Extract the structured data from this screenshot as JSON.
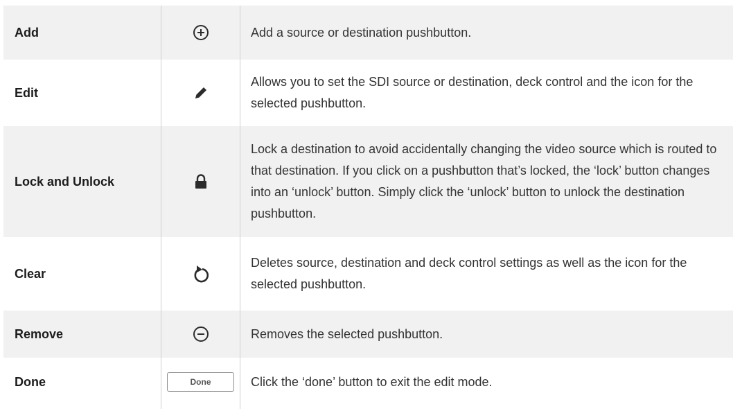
{
  "rows": [
    {
      "label": "Add",
      "icon": "plus-circle-icon",
      "description": "Add a source or destination pushbutton."
    },
    {
      "label": "Edit",
      "icon": "pencil-icon",
      "description": "Allows you to set the SDI source or destination, deck control and the icon for the selected pushbutton."
    },
    {
      "label": "Lock and Unlock",
      "icon": "lock-icon",
      "description": "Lock a destination to avoid accidentally changing the video source which is routed to that destination. If you click on a pushbutton that’s locked, the ‘lock’ button changes into an ‘unlock’ button. Simply click the ‘unlock’ button to unlock the destination pushbutton."
    },
    {
      "label": "Clear",
      "icon": "reset-arrow-icon",
      "description": "Deletes source, destination and deck control settings as well as the icon for the selected pushbutton."
    },
    {
      "label": "Remove",
      "icon": "minus-circle-icon",
      "description": "Removes the selected pushbutton."
    },
    {
      "label": "Done",
      "icon": "done-button",
      "button_label": "Done",
      "description": "Click the ‘done’ button to exit the edit mode."
    }
  ],
  "colors": {
    "shaded_row": "#f1f1f1",
    "divider": "#cfcfcf",
    "icon": "#2b2b2b"
  }
}
